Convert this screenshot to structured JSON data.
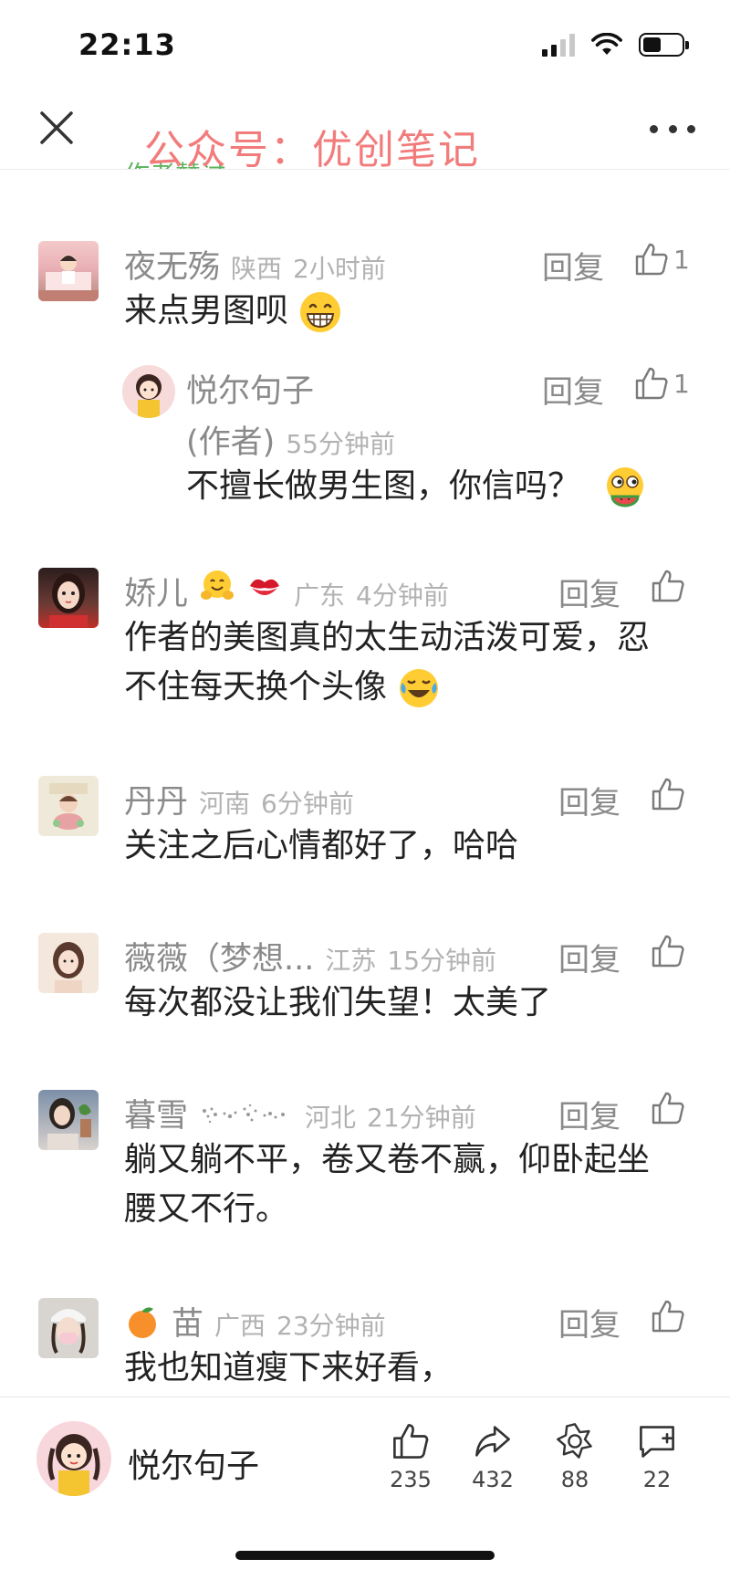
{
  "status_bar": {
    "time": "22:13",
    "battery_level": 0.48
  },
  "topnav": {
    "watermark": "公众号：优创笔记",
    "peek_text": "作者赞过"
  },
  "comments": [
    {
      "name": "夜无殇",
      "location": "陕西",
      "time": "2小时前",
      "text": "来点男图呗",
      "emoji": "grinning-face",
      "reply_label": "回复",
      "likes": "1",
      "reply": {
        "name": "悦尔句子",
        "author_tag": "(作者)",
        "time": "55分钟前",
        "text": "不擅长做男生图，你信吗？",
        "emoji": "melon-eating-face",
        "reply_label": "回复",
        "likes": "1"
      }
    },
    {
      "name": "娇儿",
      "name_emojis": [
        "hugging-face",
        "kiss-mark"
      ],
      "location": "广东",
      "time": "4分钟前",
      "text_line1": "作者的美图真的太生动活泼可爱，忍",
      "text_line2": "不住每天换个头像",
      "emoji": "crying-laughing-face",
      "reply_label": "回复"
    },
    {
      "name": "丹丹",
      "location": "河南",
      "time": "6分钟前",
      "text": "关注之后心情都好了，哈哈",
      "reply_label": "回复"
    },
    {
      "name": "薇薇（梦想...",
      "location": "江苏",
      "time": "15分钟前",
      "text": "每次都没让我们失望！太美了",
      "reply_label": "回复"
    },
    {
      "name": "暮雪",
      "name_decoration": "snowflake-dots",
      "location": "河北",
      "time": "21分钟前",
      "text_line1": "躺又躺不平，卷又卷不赢，仰卧起坐",
      "text_line2": "腰又不行。",
      "reply_label": "回复"
    },
    {
      "name": "苗",
      "name_emoji": "tangerine",
      "location": "广西",
      "time": "23分钟前",
      "text": "我也知道瘦下来好看，",
      "reply_label": "回复"
    }
  ],
  "bottom_bar": {
    "author_name": "悦尔句子",
    "likes": "235",
    "shares": "432",
    "favorites": "88",
    "comments": "22"
  },
  "colors": {
    "watermark": "#f27c7c",
    "secondary_text": "#8a8a8a",
    "meta_text": "#b2b2b2",
    "body_text": "#222222"
  }
}
